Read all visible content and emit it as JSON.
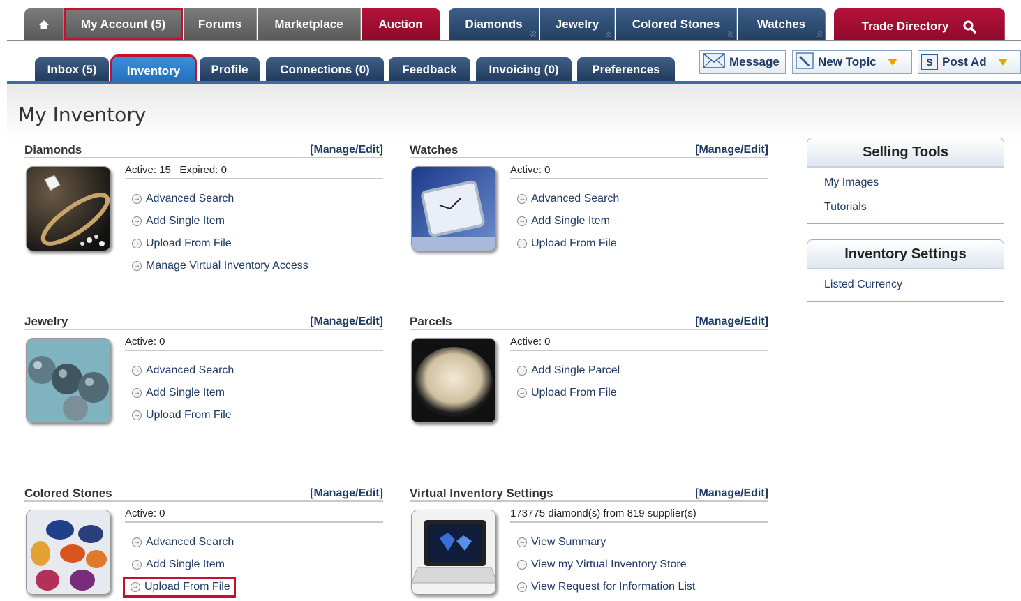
{
  "topnav": {
    "my_account": "My Account (5)",
    "forums": "Forums",
    "marketplace": "Marketplace",
    "auction": "Auction",
    "diamonds": "Diamonds",
    "jewelry": "Jewelry",
    "colored_stones": "Colored Stones",
    "watches": "Watches",
    "trade_directory": "Trade Directory"
  },
  "subnav": {
    "inbox": "Inbox (5)",
    "inventory": "Inventory",
    "profile": "Profile",
    "connections": "Connections (0)",
    "feedback": "Feedback",
    "invoicing": "Invoicing (0)",
    "preferences": "Preferences"
  },
  "actions": {
    "message": "Message",
    "new_topic": "New Topic",
    "post_ad": "Post Ad",
    "post_ad_icon_text": "S"
  },
  "page_title": "My Inventory",
  "manage_label": "[Manage/Edit]",
  "sections": {
    "diamonds": {
      "title": "Diamonds",
      "stat": "Active: 15   Expired: 0",
      "links": [
        "Advanced Search",
        "Add Single Item",
        "Upload From File",
        "Manage Virtual Inventory Access"
      ]
    },
    "watches": {
      "title": "Watches",
      "stat": "Active: 0",
      "links": [
        "Advanced Search",
        "Add Single Item",
        "Upload From File"
      ]
    },
    "jewelry": {
      "title": "Jewelry",
      "stat": "Active: 0",
      "links": [
        "Advanced Search",
        "Add Single Item",
        "Upload From File"
      ]
    },
    "parcels": {
      "title": "Parcels",
      "stat": "Active: 0",
      "links": [
        "Add Single Parcel",
        "Upload From File"
      ]
    },
    "colored_stones": {
      "title": "Colored Stones",
      "stat": "Active: 0",
      "links": [
        "Advanced Search",
        "Add Single Item",
        "Upload From File"
      ]
    },
    "virtual": {
      "title": "Virtual Inventory Settings",
      "stat": "173775 diamond(s) from 819 supplier(s)",
      "links": [
        "View Summary",
        "View my Virtual Inventory Store",
        "View Request for Information List"
      ]
    }
  },
  "selling_tools": {
    "title": "Selling Tools",
    "items": [
      "My Images",
      "Tutorials"
    ]
  },
  "inventory_settings": {
    "title": "Inventory Settings",
    "items": [
      "Listed Currency"
    ]
  },
  "colors": {
    "brand_red": "#b5123a",
    "nav_blue": "#243f63",
    "active_tab": "#1f6cb8",
    "highlight_box": "#c8102e"
  }
}
